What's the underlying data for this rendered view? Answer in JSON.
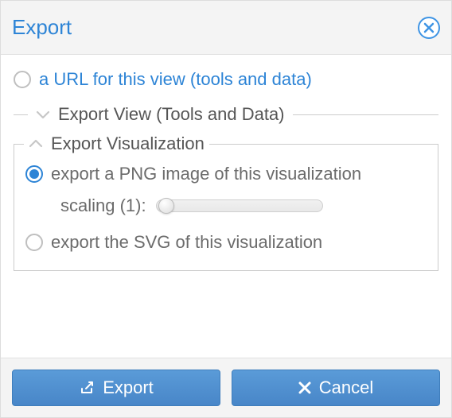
{
  "dialog": {
    "title": "Export"
  },
  "options": {
    "url_view": "a URL for this view (tools and data)"
  },
  "sections": {
    "export_view": {
      "label": "Export View (Tools and Data)"
    },
    "export_viz": {
      "label": "Export Visualization",
      "png": "export a PNG image of this visualization",
      "svg": "export the SVG of this visualization",
      "scaling_label": "scaling (1):",
      "scaling_value": 1
    }
  },
  "buttons": {
    "export": "Export",
    "cancel": "Cancel"
  }
}
